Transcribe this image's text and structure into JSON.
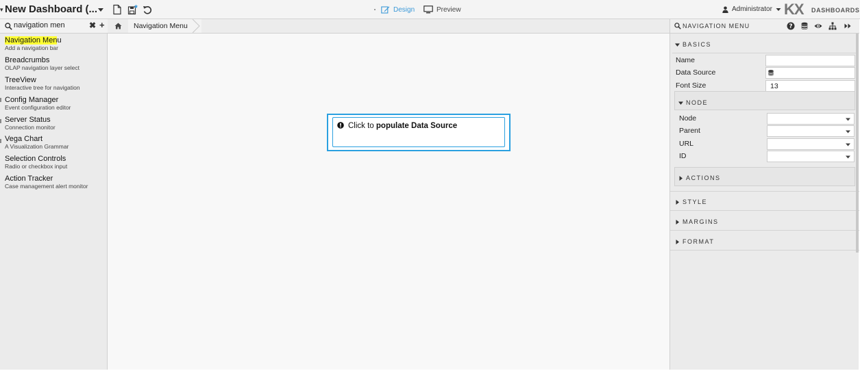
{
  "topbar": {
    "title": "New Dashboard (...",
    "design_label": "Design",
    "preview_label": "Preview",
    "user_label": "Administrator",
    "brand_logo": "KX",
    "brand_sub": "DASHBOARDS",
    "accent_color": "#3a98d8"
  },
  "left_panel": {
    "search_value": "navigation men",
    "components": [
      {
        "title": "Navigation Menu",
        "highlight": "Navigation Men",
        "rest": "u",
        "desc": "Add a navigation bar"
      },
      {
        "title": "Breadcrumbs",
        "desc": "OLAP navigation layer select"
      },
      {
        "title": "TreeView",
        "desc": "Interactive tree for navigation"
      },
      {
        "title": "Config Manager",
        "desc": "Event configuration editor"
      },
      {
        "title": "Server Status",
        "desc": "Connection monitor"
      },
      {
        "title": "Vega Chart",
        "desc": "A Visualization Grammar"
      },
      {
        "title": "Selection Controls",
        "desc": "Radio or checkbox input"
      },
      {
        "title": "Action Tracker",
        "desc": "Case management alert monitor"
      }
    ]
  },
  "center": {
    "breadcrumb": "Navigation Menu",
    "alert_prefix": "Click to ",
    "alert_bold": "populate Data Source",
    "alert_border_color": "#2aa0e0"
  },
  "right_panel": {
    "title": "NAVIGATION MENU",
    "sections": {
      "basics": "BASICS",
      "node": "NODE",
      "actions": "ACTIONS",
      "style": "STYLE",
      "margins": "MARGINS",
      "format": "FORMAT"
    },
    "basics": {
      "name_label": "Name",
      "name_value": "",
      "datasource_label": "Data Source",
      "fontsize_label": "Font Size",
      "fontsize_value": "13"
    },
    "node": {
      "node_label": "Node",
      "parent_label": "Parent",
      "url_label": "URL",
      "id_label": "ID"
    }
  }
}
